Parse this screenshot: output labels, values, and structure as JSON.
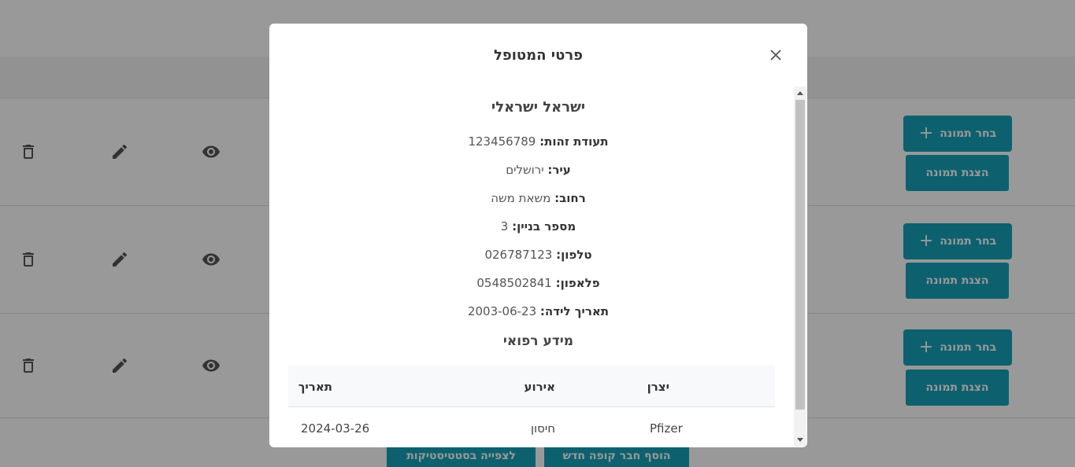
{
  "background": {
    "page_title": "",
    "rows": [
      {
        "choose_label": "בחר תמונה",
        "show_label": "הצגת תמונה"
      },
      {
        "choose_label": "בחר תמונה",
        "show_label": "הצגת תמונה"
      },
      {
        "choose_label": "בחר תמונה",
        "show_label": "הצגת תמונה"
      }
    ],
    "footer": {
      "add_member_label": "הוסף חבר קופה חדש",
      "statistics_label": "לצפייה בסטטיסטיקות"
    }
  },
  "modal": {
    "title": "פרטי המטופל",
    "patient_name": "ישראל ישראלי",
    "fields": [
      {
        "label": "תעודת זהות:",
        "value": "123456789"
      },
      {
        "label": "עיר:",
        "value": "ירושלים"
      },
      {
        "label": "רחוב:",
        "value": "משאת משה"
      },
      {
        "label": "מספר בניין:",
        "value": "3"
      },
      {
        "label": "טלפון:",
        "value": "026787123"
      },
      {
        "label": "פלאפון:",
        "value": "0548502841"
      },
      {
        "label": "תאריך לידה:",
        "value": "2003-06-23"
      }
    ],
    "medical_title": "מידע רפואי",
    "medical_table": {
      "headers": {
        "manufacturer": "יצרן",
        "event": "אירוע",
        "date": "תאריך"
      },
      "rows": [
        {
          "manufacturer": "Pfizer",
          "event": "חיסון",
          "date": "2024-03-26"
        }
      ]
    }
  },
  "colors": {
    "accent": "#17a2b8",
    "overlay": "rgba(0,0,0,0.4)"
  }
}
